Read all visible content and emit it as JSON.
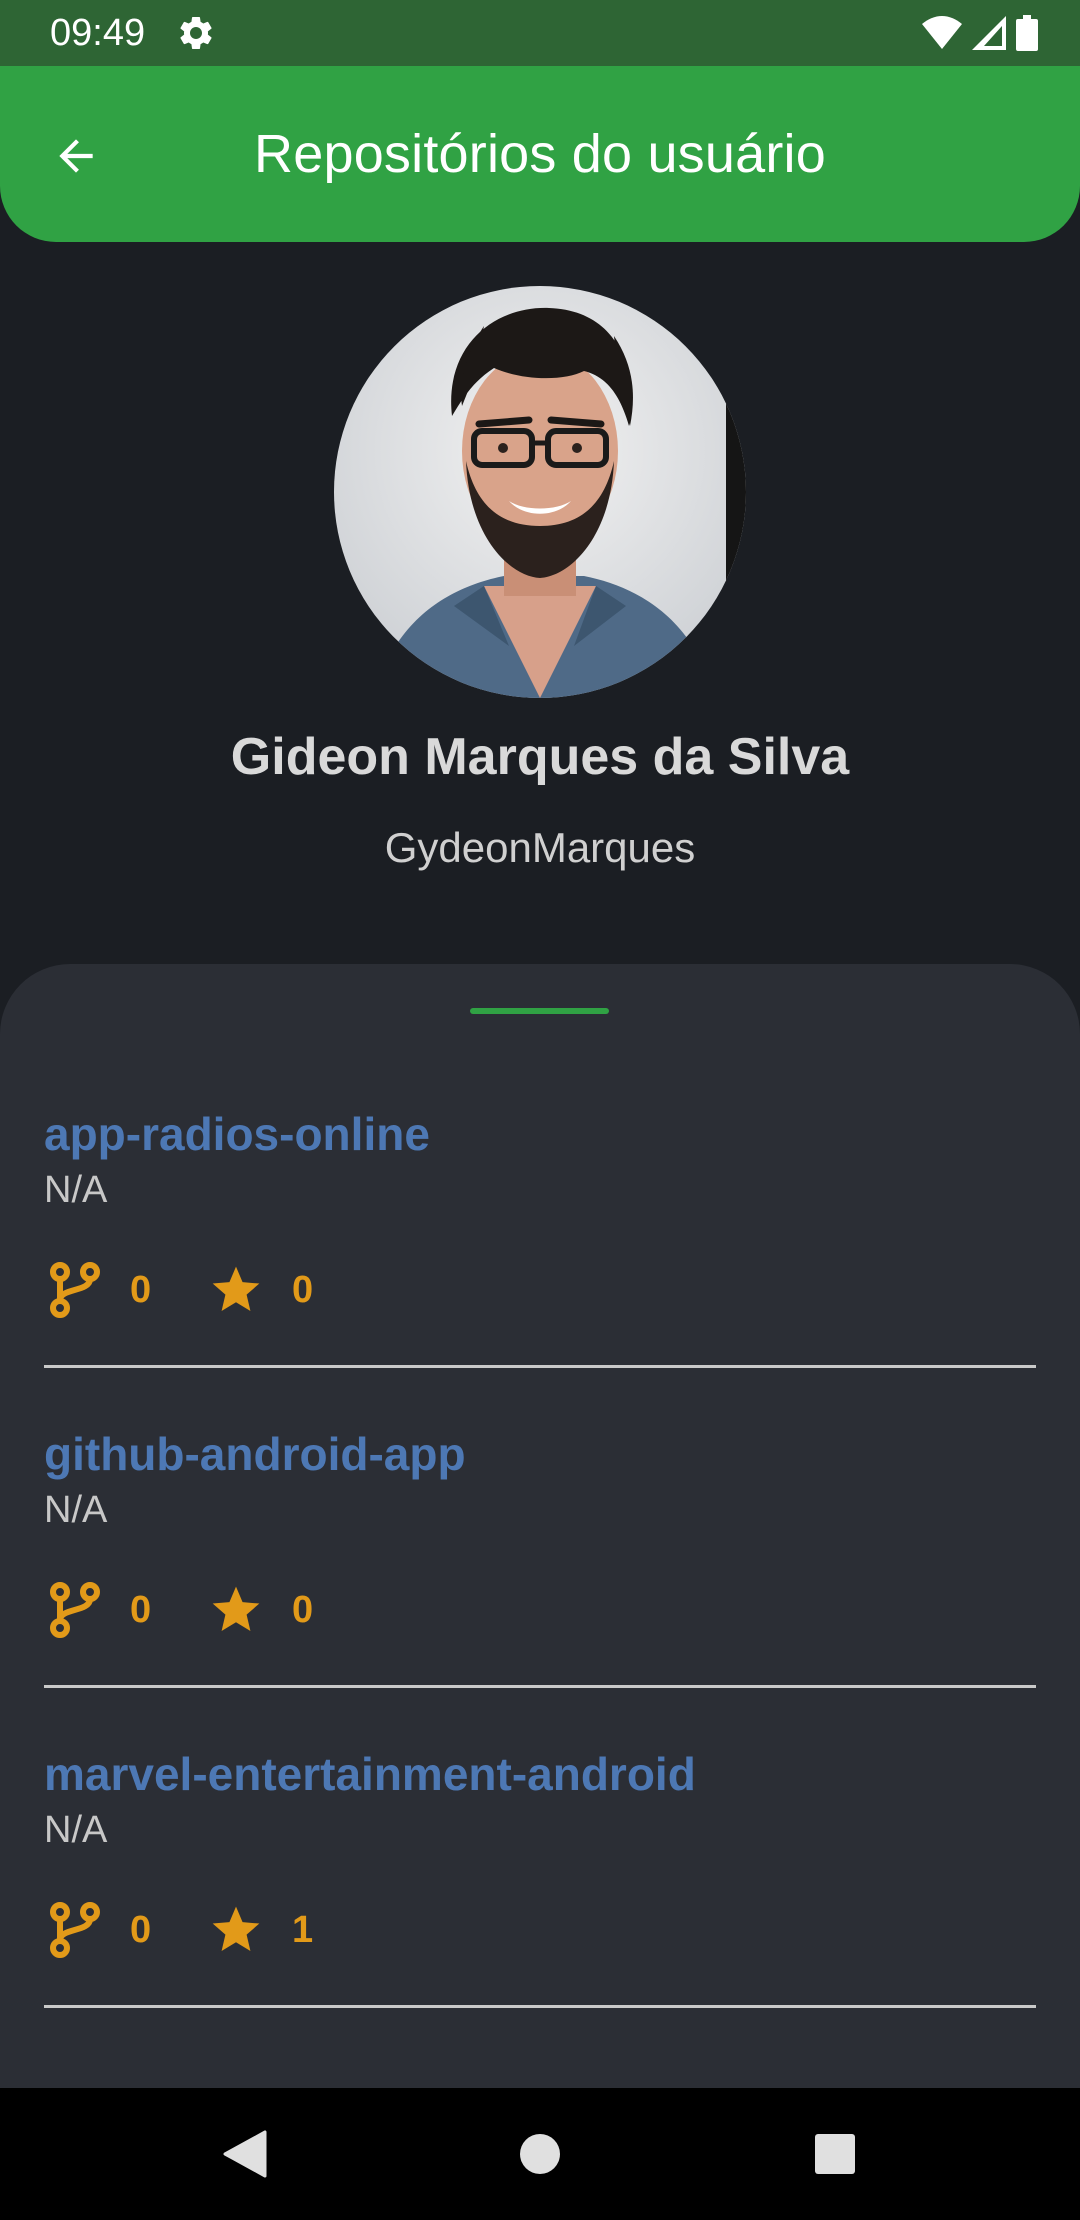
{
  "status_bar": {
    "time": "09:49",
    "icons": [
      "gear-icon",
      "wifi-icon",
      "signal-icon",
      "battery-icon"
    ]
  },
  "app_bar": {
    "title": "Repositórios do usuário",
    "back_icon": "arrow-back-icon",
    "color": "#30a244"
  },
  "profile": {
    "name": "Gideon Marques da Silva",
    "login": "GydeonMarques"
  },
  "repositories": [
    {
      "name": "app-radios-online",
      "description": "N/A",
      "forks": "0",
      "stars": "0"
    },
    {
      "name": "github-android-app",
      "description": "N/A",
      "forks": "0",
      "stars": "0"
    },
    {
      "name": "marvel-entertainment-android",
      "description": "N/A",
      "forks": "0",
      "stars": "1"
    }
  ],
  "colors": {
    "accent": "#30a244",
    "repo_name": "#4d78b4",
    "stat": "#e29a19",
    "background": "#1b1e23",
    "sheet": "#2b2e35"
  },
  "nav_bar": {
    "icons": [
      "back-triangle-icon",
      "home-circle-icon",
      "recents-square-icon"
    ]
  }
}
